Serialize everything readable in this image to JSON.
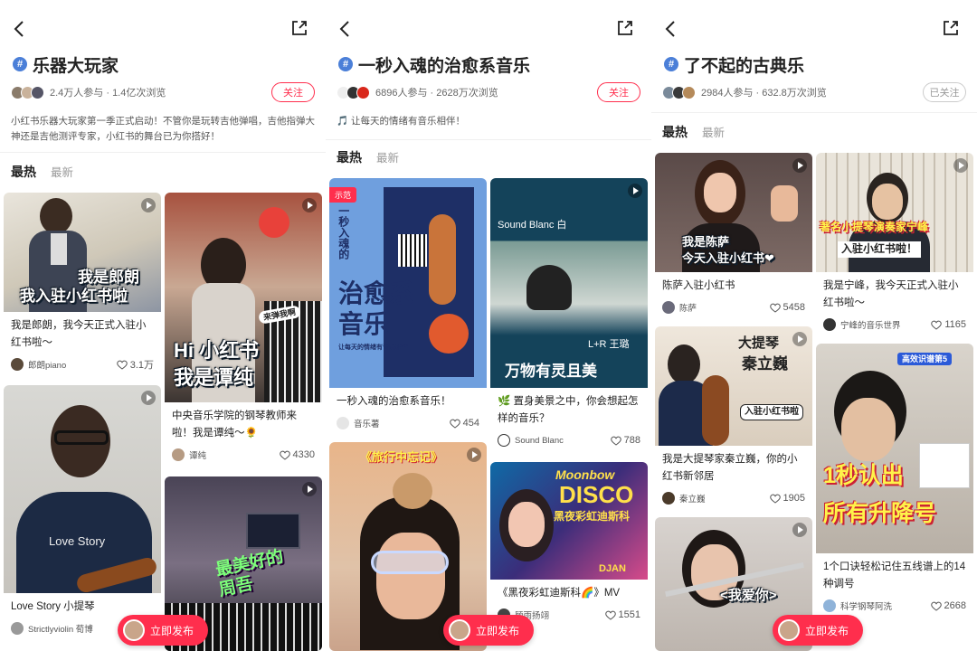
{
  "colors": {
    "accent": "#ff2e4d",
    "topic_icon": "#4b7fd8"
  },
  "panels": [
    {
      "title": "乐器大玩家",
      "stats": "2.4万人参与 · 1.4亿次浏览",
      "follow_label": "关注",
      "description": "小红书乐器大玩家第一季正式启动！不管你是玩转吉他弹唱，吉他指弹大神还是吉他测评专家，小红书的舞台已为你搭好！",
      "tabs": {
        "hot": "最热",
        "new": "最新"
      },
      "publish_label": "立即发布",
      "cards": [
        {
          "overlay": [
            "我是郎朗",
            "我入驻小红书啦"
          ],
          "title": "我是郎朗，我今天正式入驻小红书啦～",
          "user": "郎朗piano",
          "likes": "3.1万"
        },
        {
          "overlay": [
            "Hi 小红书",
            "我是谭纯"
          ],
          "tag": "来弹我啊",
          "title": "中央音乐学院的钢琴教师来啦！我是谭纯～🌻",
          "user": "谭纯",
          "likes": "4330"
        },
        {
          "overlay": [
            "Love Story"
          ],
          "title": "Love Story 小提琴",
          "user": "Strictlyviolin 荀博",
          "likes": ""
        },
        {
          "overlay": [
            "最美好的",
            "周吾"
          ],
          "title": "",
          "user": "",
          "likes": ""
        }
      ]
    },
    {
      "title": "一秒入魂的治愈系音乐",
      "stats": "6896人参与 · 2628万次浏览",
      "follow_label": "关注",
      "description": "🎵 让每天的情绪有音乐相伴！",
      "tabs": {
        "hot": "最热",
        "new": "最新"
      },
      "publish_label": "立即发布",
      "cards": [
        {
          "badge": "示范",
          "overlay": [
            "一秒入魂的",
            "治愈系",
            "音乐"
          ],
          "poster_sub": "让每天的情绪有音乐相伴",
          "title": "一秒入魂的治愈系音乐！",
          "user": "音乐薯",
          "likes": "454"
        },
        {
          "overlay": [
            "Sound Blanc 白",
            "L+R 王璐",
            "万物有灵且美"
          ],
          "title": "🌿 置身美景之中，你会想起怎样的音乐？",
          "user": "Sound Blanc",
          "likes": "788"
        },
        {
          "overlay": [
            "《旅行中忘记》"
          ],
          "title": "",
          "user": "",
          "likes": ""
        },
        {
          "overlay": [
            "Moonbow",
            "DISCO",
            "黑夜彩虹迪斯科",
            "DJAN"
          ],
          "title": "《黑夜彩虹迪斯科🌈》MV",
          "user": "顾雨扬翊",
          "likes": "1551"
        }
      ]
    },
    {
      "title": "了不起的古典乐",
      "stats": "2984人参与 · 632.8万次浏览",
      "follow_label": "已关注",
      "description": "",
      "tabs": {
        "hot": "最热",
        "new": "最新"
      },
      "publish_label": "立即发布",
      "cards": [
        {
          "overlay": [
            "我是陈萨",
            "今天入驻小红书❤"
          ],
          "title": "陈萨入驻小红书",
          "user": "陈萨",
          "likes": "5458"
        },
        {
          "overlay": [
            "著名小提琴演奏家宁峰",
            "入驻小红书啦！"
          ],
          "title": "我是宁峰，我今天正式入驻小红书啦～",
          "user": "宁峰的音乐世界",
          "likes": "1165"
        },
        {
          "overlay": [
            "大提琴",
            "秦立巍",
            "入驻小红书啦"
          ],
          "title": "我是大提琴家秦立巍，你的小红书新邻居",
          "user": "秦立巍",
          "likes": "1905"
        },
        {
          "tag": "高效识谱第5",
          "overlay": [
            "1秒认出",
            "所有升降号"
          ],
          "title": "1个口诀轻松记住五线谱上的14种调号",
          "user": "科学钢琴阿洗",
          "likes": "2668"
        },
        {
          "overlay": [
            "<我爱你>"
          ],
          "title": "",
          "user": "",
          "likes": ""
        }
      ]
    }
  ]
}
